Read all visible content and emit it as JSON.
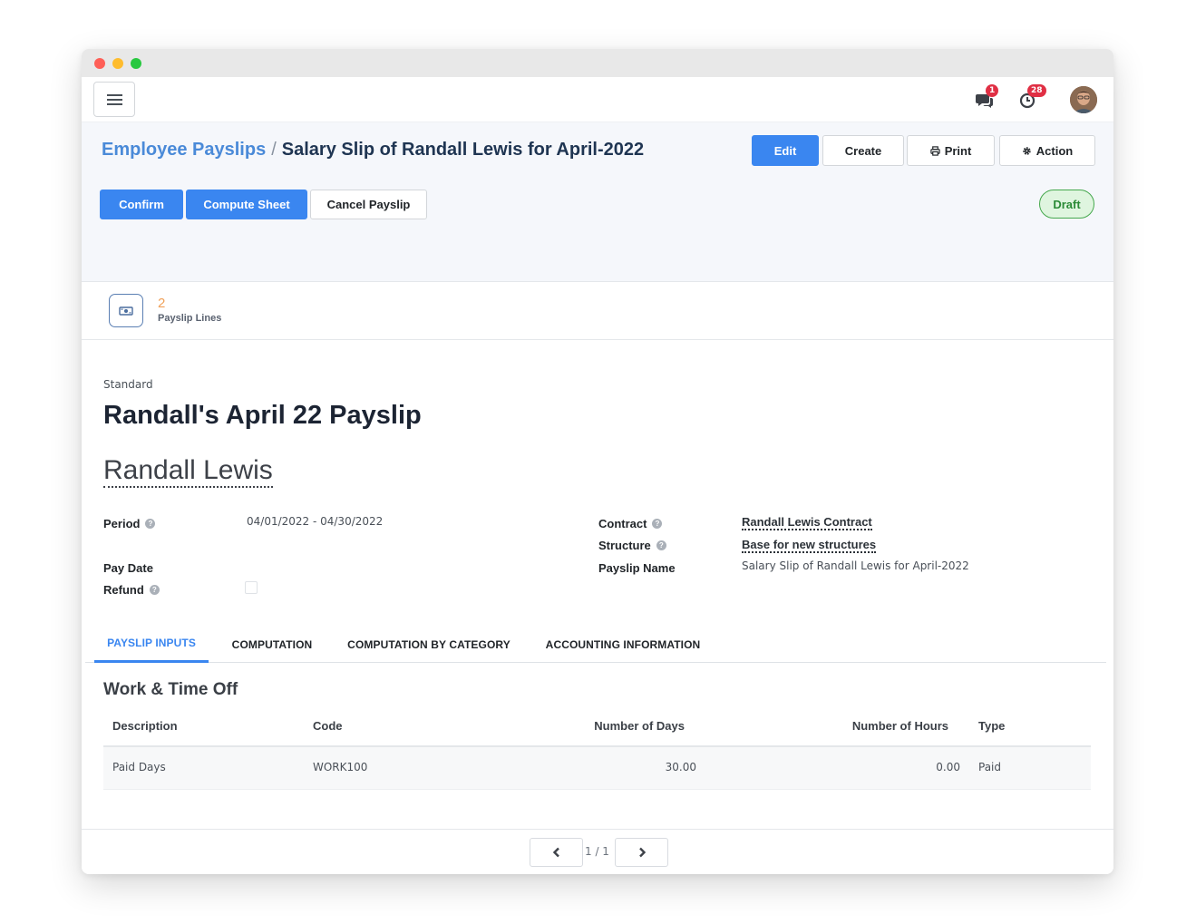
{
  "topnav": {
    "messages_badge": "1",
    "activities_badge": "28"
  },
  "breadcrumb": {
    "parent": "Employee Payslips",
    "separator": "/",
    "current": "Salary Slip of Randall Lewis for April-2022"
  },
  "actions": {
    "edit": "Edit",
    "create": "Create",
    "print": "Print",
    "action": "Action"
  },
  "header_buttons": {
    "confirm": "Confirm",
    "compute_sheet": "Compute Sheet",
    "cancel_payslip": "Cancel Payslip"
  },
  "status": "Draft",
  "smart_button": {
    "count": "2",
    "label": "Payslip Lines"
  },
  "form": {
    "structure_type": "Standard",
    "name": "Randall's April 22 Payslip",
    "employee": "Randall Lewis",
    "period_label": "Period",
    "period_value": "04/01/2022 - 04/30/2022",
    "pay_date_label": "Pay Date",
    "refund_label": "Refund",
    "contract_label": "Contract",
    "contract_value": "Randall Lewis Contract",
    "structure_label": "Structure",
    "structure_value": "Base for new structures",
    "payslip_name_label": "Payslip Name",
    "payslip_name_value": "Salary Slip of Randall Lewis for April-2022"
  },
  "tabs": [
    "PAYSLIP INPUTS",
    "COMPUTATION",
    "COMPUTATION BY CATEGORY",
    "ACCOUNTING INFORMATION"
  ],
  "worked_days": {
    "title": "Work & Time Off",
    "columns": [
      "Description",
      "Code",
      "Number of Days",
      "Number of Hours",
      "Type"
    ],
    "rows": [
      [
        "Paid Days",
        "WORK100",
        "30.00",
        "0.00",
        "Paid"
      ]
    ]
  },
  "pager": {
    "value": "1 / 1"
  },
  "colors": {
    "primary": "#3a86f0",
    "breadcrumb_link": "#4a8ad8",
    "status_draft": "#2a8a36",
    "badge": "#e02f44"
  }
}
